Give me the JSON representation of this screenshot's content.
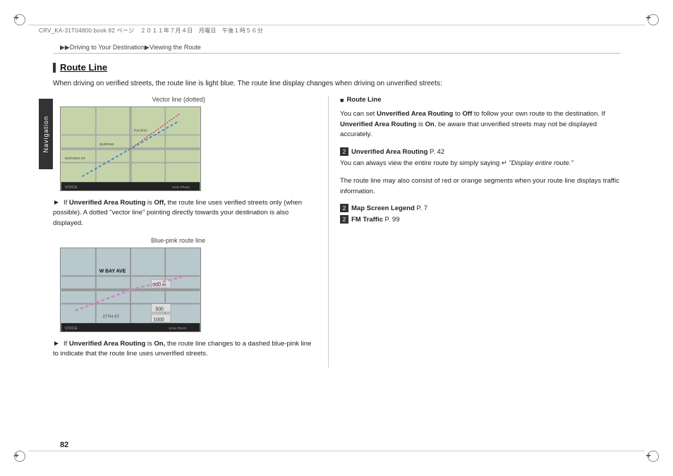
{
  "page": {
    "number": "82",
    "file_info": "CRV_KA-31T04800.book  82 ページ　２０１１年７月４日　月曜日　午後１時５６分"
  },
  "breadcrumb": {
    "text": "▶▶Driving to Your Destination▶Viewing the Route"
  },
  "nav_tab": {
    "label": "Navigation"
  },
  "section": {
    "title": "Route Line"
  },
  "intro": {
    "text": "When driving on verified streets, the route line is light blue. The route line display changes when driving on unverified streets:"
  },
  "image1": {
    "label": "Vector line (dotted)"
  },
  "image2": {
    "label": "Blue-pink route line"
  },
  "bullet1": {
    "arrow": "►",
    "text_parts": [
      {
        "text": "If ",
        "bold": false
      },
      {
        "text": "Unverified Area Routing",
        "bold": true
      },
      {
        "text": " is ",
        "bold": false
      },
      {
        "text": "Off,",
        "bold": true
      },
      {
        "text": " the route line uses verified streets only (when possible). A dotted \"vector line\" pointing directly towards your destination is also displayed.",
        "bold": false
      }
    ]
  },
  "bullet2": {
    "arrow": "►",
    "text_parts": [
      {
        "text": "If ",
        "bold": false
      },
      {
        "text": "Unverified Area Routing",
        "bold": true
      },
      {
        "text": " is ",
        "bold": false
      },
      {
        "text": "On,",
        "bold": true
      },
      {
        "text": " the route line changes to a dashed blue-pink line to indicate that the route line uses unverified streets.",
        "bold": false
      }
    ]
  },
  "right_col": {
    "section_title": "Route Line",
    "para1": {
      "text": "You can set Unverified Area Routing to Off to follow your own route to the destination. If Unverified Area Routing is On, be aware that unverified streets may not be displayed accurately."
    },
    "ref1": {
      "icon": "2",
      "text": "Unverified Area Routing",
      "page": "P. 42"
    },
    "para2": {
      "text": "You can always view the entire route by simply saying    \"Display entire route.\""
    },
    "para3": {
      "text": "The route line may also consist of red or orange segments when your route line displays traffic information."
    },
    "ref2": {
      "icon": "2",
      "text": "Map Screen Legend",
      "page": "P. 7"
    },
    "ref3": {
      "icon": "2",
      "text": "FM Traffic",
      "page": "P. 99"
    }
  }
}
